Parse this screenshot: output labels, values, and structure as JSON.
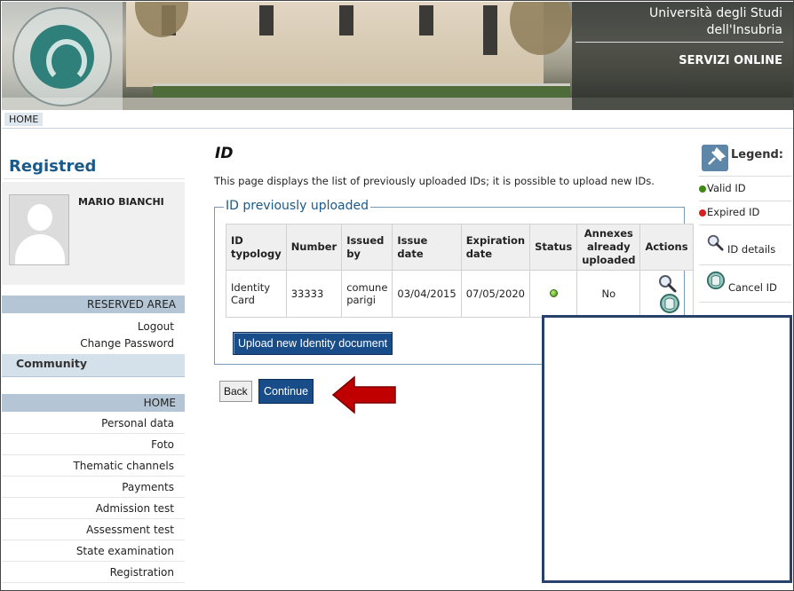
{
  "header": {
    "university_line1": "Università degli Studi",
    "university_line2": "dell'Insubria",
    "services": "SERVIZI ONLINE",
    "logo_text": "UNIVERSITAS STUDIORUM INSUBRIAE"
  },
  "breadcrumb": {
    "home": "HOME"
  },
  "sidebar": {
    "title": "Registred",
    "user_name": "MARIO BIANCHI",
    "reserved_area": "RESERVED AREA",
    "logout": "Logout",
    "change_password": "Change Password",
    "community": "Community",
    "home": "HOME",
    "menu": [
      "Personal data",
      "Foto",
      "Thematic channels",
      "Payments",
      "Admission test",
      "Assessment test",
      "State examination",
      "Registration"
    ]
  },
  "main": {
    "title": "ID",
    "intro": "This page displays the list of previously uploaded IDs; it is possible to upload new IDs.",
    "fieldset_title": "ID previously uploaded",
    "table": {
      "headers": [
        "ID typology",
        "Number",
        "Issued by",
        "Issue date",
        "Expiration date",
        "Status",
        "Annexes already uploaded",
        "Actions"
      ],
      "rows": [
        {
          "typology": "Identity Card",
          "number": "33333",
          "issued_by": "comune parigi",
          "issue_date": "03/04/2015",
          "expiration_date": "07/05/2020",
          "status": "valid",
          "annexes": "No"
        }
      ]
    },
    "upload_button": "Upload new Identity document",
    "back_button": "Back",
    "continue_button": "Continue"
  },
  "legend": {
    "title": "Legend:",
    "valid": "Valid ID",
    "expired": "Expired ID",
    "details": "ID details",
    "cancel": "Cancel ID"
  },
  "colors": {
    "primary_button": "#184d8a",
    "section_header": "#b4c6d5",
    "title_blue": "#1a5a8a",
    "arrow_red": "#c00000",
    "valid_green": "#3d8a14",
    "expired_red": "#d42020"
  },
  "icons": {
    "details": "magnifier-icon",
    "cancel": "cancel-globe-icon",
    "legend": "pin-icon",
    "arrow": "left-arrow-icon"
  }
}
